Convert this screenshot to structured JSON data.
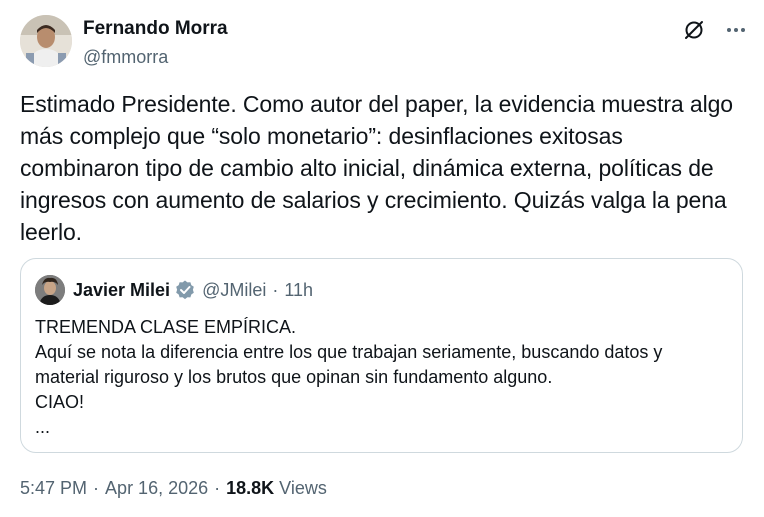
{
  "author": {
    "name": "Fernando Morra",
    "handle": "@fmmorra"
  },
  "tweet": {
    "text": "Estimado Presidente. Como autor del paper, la evidencia muestra algo\nmás complejo que “solo monetario”: desinflaciones exitosas\ncombinaron tipo de cambio alto inicial, dinámica externa, políticas de\ningresos con aumento de salarios y crecimiento. Quizás valga la pena\nleerlo."
  },
  "quoted": {
    "name": "Javier Milei",
    "handle": "@JMilei",
    "dot": "·",
    "time": "11h",
    "text": "TREMENDA CLASE EMPÍRICA.\nAquí se nota la diferencia entre los que trabajan seriamente, buscando datos y\nmaterial riguroso y los brutos que opinan sin fundamento alguno.\nCIAO!\n..."
  },
  "meta": {
    "time": "5:47 PM",
    "sep1": "·",
    "date": "Apr 16, 2026",
    "sep2": "·",
    "views_count": "18.8K",
    "views_label": "Views"
  },
  "icons": {
    "grok": "grok-icon",
    "more": "more-icon",
    "verified": "verified-badge-icon"
  },
  "colors": {
    "text": "#0f1419",
    "secondary": "#536471",
    "border": "#cfd9de",
    "verified_badge": "#829aab"
  }
}
